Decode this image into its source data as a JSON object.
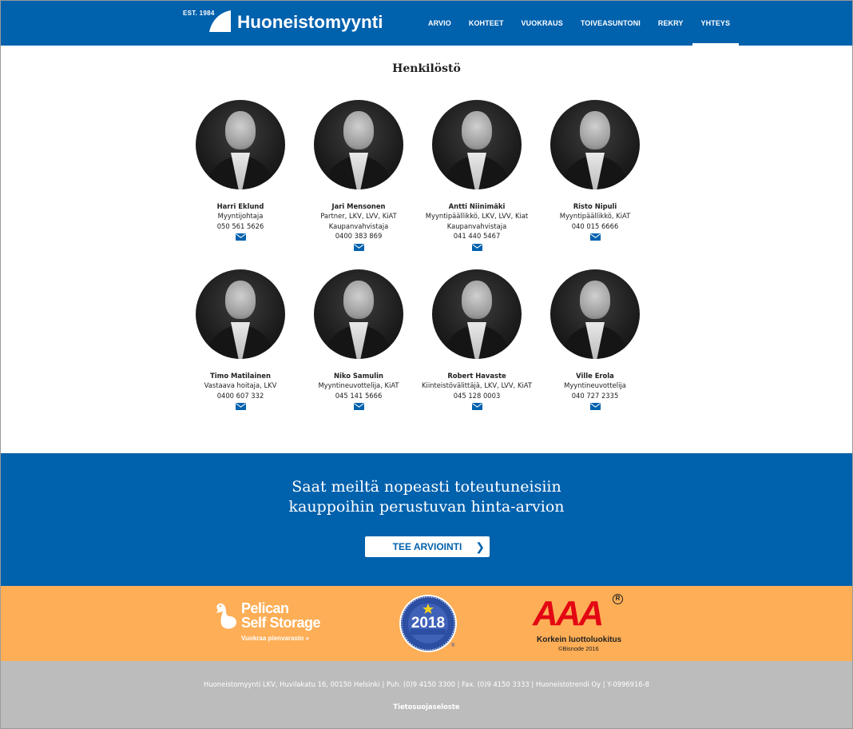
{
  "header": {
    "logo": {
      "est": "EST. 1984",
      "name": "Huoneistomyynti"
    },
    "nav": [
      {
        "label": "ARVIO",
        "active": false
      },
      {
        "label": "KOHTEET",
        "active": false
      },
      {
        "label": "VUOKRAUS",
        "active": false
      },
      {
        "label": "TOIVEASUNTONI",
        "active": false
      },
      {
        "label": "REKRY",
        "active": false
      },
      {
        "label": "YHTEYS",
        "active": true
      }
    ]
  },
  "staff": {
    "title": "Henkilöstö",
    "people": [
      {
        "name": "Harri Eklund",
        "title_lines": [
          "Myyntijohtaja"
        ],
        "phone": "050 561 5626",
        "icon": "envelope-icon"
      },
      {
        "name": "Jari Mensonen",
        "title_lines": [
          "Partner, LKV, LVV, KiAT",
          "Kaupanvahvistaja"
        ],
        "phone": "0400 383 869",
        "icon": "envelope-icon"
      },
      {
        "name": "Antti Niinimäki",
        "title_lines": [
          "Myyntipäällikkö, LKV, LVV, Kiat",
          "Kaupanvahvistaja"
        ],
        "phone": "041 440 5467",
        "icon": "envelope-icon"
      },
      {
        "name": "Risto Nipuli",
        "title_lines": [
          "Myyntipäällikkö, KiAT"
        ],
        "phone": "040 015 6666",
        "icon": "envelope-icon"
      },
      {
        "name": "Timo Matilainen",
        "title_lines": [
          "Vastaava hoitaja, LKV"
        ],
        "phone": "0400 607 332",
        "icon": "envelope-icon"
      },
      {
        "name": "Niko Samulin",
        "title_lines": [
          "Myyntineuvottelija, KiAT"
        ],
        "phone": "045 141 5666",
        "icon": "envelope-icon"
      },
      {
        "name": "Robert Havaste",
        "title_lines": [
          "Kiinteistövälittäjä, LKV, LVV, KiAT"
        ],
        "phone": "045 128 0003",
        "icon": "envelope-icon"
      },
      {
        "name": "Ville Erola",
        "title_lines": [
          "Myyntineuvottelija"
        ],
        "phone": "040 727 2335",
        "icon": "envelope-icon"
      }
    ]
  },
  "cta": {
    "line1": "Saat meiltä nopeasti toteutuneisiin",
    "line2": "kauppoihin perustuvan hinta-arvion",
    "button_label": "TEE ARVIOINTI",
    "button_icon": "chevron-right-icon"
  },
  "partners": {
    "pelican": {
      "line1": "Pelican",
      "line2": "Self Storage",
      "tagline": "Vuokraa pienvarasto »"
    },
    "badge": {
      "year": "2018"
    },
    "aaa": {
      "letters": "AAA",
      "reg": "R",
      "caption": "Korkein luottoluokitus",
      "source": "©Bisnode 2016"
    }
  },
  "footer": {
    "address": "Huoneistomyynti LKV, Huvilakatu 16, 00150 Helsinki | Puh. (0)9 4150 3300 | Fax. (0)9 4150 3333 | Huoneistotrendi Oy | Y-0996916-8",
    "privacy_link": "Tietosuojaseloste"
  },
  "colors": {
    "brand_blue": "#0061ad",
    "partner_orange": "#fdae56",
    "footer_gray": "#bcbcbc",
    "aaa_red": "#e30613"
  }
}
